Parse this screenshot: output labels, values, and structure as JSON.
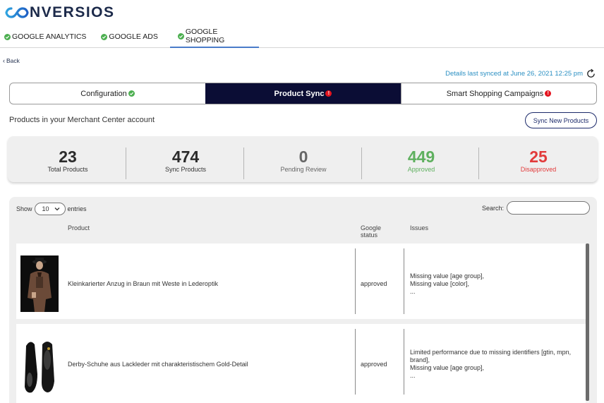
{
  "brand": {
    "logo_text": "NVERSIOS"
  },
  "nav": {
    "items": [
      {
        "label": "GOOGLE ANALYTICS"
      },
      {
        "label": "GOOGLE ADS"
      },
      {
        "label": "GOOGLE SHOPPING",
        "active": true
      }
    ]
  },
  "back_label": "Back",
  "sync_info": "Details last synced at June 26, 2021 12:25 pm",
  "tabs": [
    {
      "label": "Configuration",
      "status": "ok"
    },
    {
      "label": "Product Sync",
      "status": "alert",
      "active": true
    },
    {
      "label": "Smart Shopping Campaigns",
      "status": "alert"
    }
  ],
  "alert_glyph": "!",
  "section_title": "Products in your Merchant Center account",
  "sync_button": "Sync New Products",
  "stats": [
    {
      "value": "23",
      "label": "Total Products"
    },
    {
      "value": "474",
      "label": "Sync Products"
    },
    {
      "value": "0",
      "label": "Pending Review"
    },
    {
      "value": "449",
      "label": "Approved"
    },
    {
      "value": "25",
      "label": "Disapproved"
    }
  ],
  "table": {
    "show_label": "Show",
    "entries_value": "10",
    "entries_label": "entries",
    "search_label": "Search:",
    "search_value": "",
    "headers": {
      "product": "Product",
      "status_line1": "Google",
      "status_line2": "status",
      "issues": "Issues"
    },
    "rows": [
      {
        "product": "Kleinkarierter Anzug in Braun mit Weste in Lederoptik",
        "status": "approved",
        "issues": [
          "Missing value [age group],",
          "Missing value [color],",
          "..."
        ]
      },
      {
        "product": "Derby-Schuhe aus Lackleder mit charakteristischem Gold-Detail",
        "status": "approved",
        "issues": [
          "Limited performance due to missing identifiers [gtin, mpn,",
          "brand],",
          "Missing value [age group],",
          "..."
        ]
      }
    ]
  },
  "colors": {
    "brand_dark": "#1c2a4a",
    "logo_blue": "#2f7fd0",
    "active_tab_bg": "#0b0d35",
    "approved_green": "#5fb05f",
    "disapproved_red": "#e23b3b",
    "alert_red": "#e4141f",
    "check_green": "#4caf50",
    "link_blue": "#2a8fc2"
  }
}
